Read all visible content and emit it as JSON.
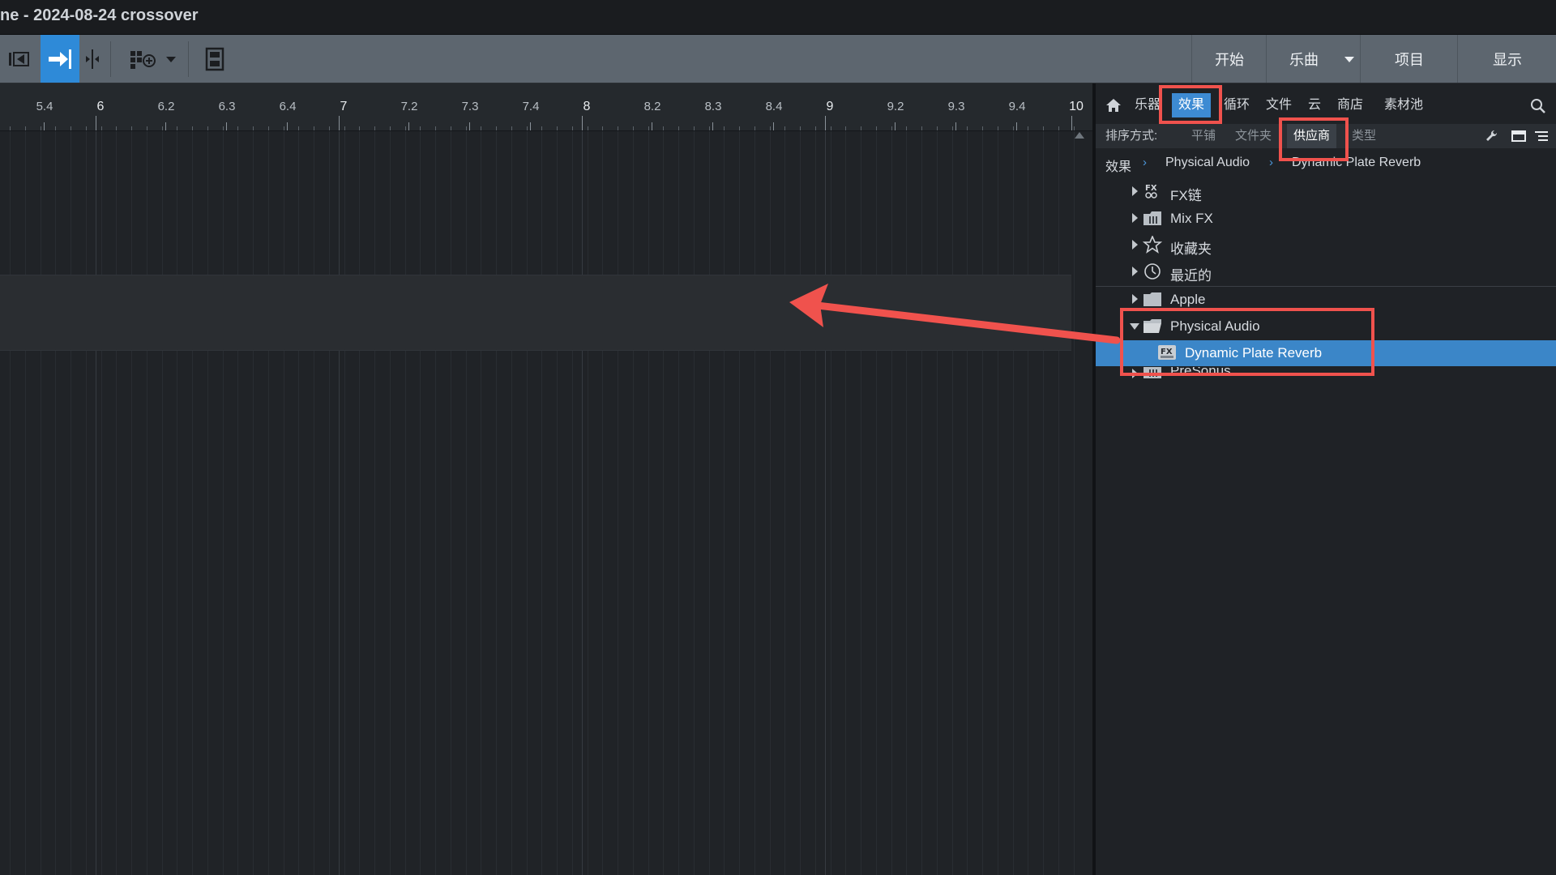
{
  "window": {
    "title": "ne - 2024-08-24 crossover"
  },
  "toolbar": {
    "tool_icons": [
      "timeline-start-icon",
      "snap-arrow-icon",
      "split-cursor-icon",
      "grid-add-icon",
      "chevron-down-icon",
      "film-icon"
    ],
    "nav": {
      "start": "开始",
      "song": "乐曲",
      "project": "项目",
      "show": "显示"
    }
  },
  "ruler": {
    "labels": [
      "5.4",
      "6",
      "6.2",
      "6.3",
      "6.4",
      "7",
      "7.2",
      "7.3",
      "7.4",
      "8",
      "8.2",
      "8.3",
      "8.4",
      "9",
      "9.2",
      "9.3",
      "9.4",
      "10"
    ]
  },
  "browser": {
    "tabs": {
      "instruments": "乐器",
      "effects": "效果",
      "loops": "循环",
      "files": "文件",
      "cloud": "云",
      "shop": "商店",
      "pool": "素材池"
    },
    "sort": {
      "label": "排序方式:",
      "flat": "平铺",
      "folder": "文件夹",
      "vendor": "供应商",
      "type": "类型"
    },
    "breadcrumb": [
      "效果",
      "Physical Audio",
      "Dynamic Plate Reverb"
    ],
    "tree": [
      {
        "label": "FX链",
        "icon": "fx-chain-icon"
      },
      {
        "label": "Mix FX",
        "icon": "mixer-icon"
      },
      {
        "label": "收藏夹",
        "icon": "star-icon"
      },
      {
        "label": "最近的",
        "icon": "clock-icon"
      },
      {
        "label": "Apple",
        "icon": "folder-icon"
      },
      {
        "label": "Physical Audio",
        "icon": "folder-open-icon",
        "expanded": true
      },
      {
        "label": "Dynamic Plate Reverb",
        "icon": "fx-plugin-icon",
        "selected": true
      },
      {
        "label": "PreSonus",
        "icon": "mixer-icon"
      }
    ]
  },
  "colors": {
    "accent": "#3b86c8",
    "annotation": "#f0524d",
    "toolbar": "#5d666f",
    "background": "#202327"
  }
}
